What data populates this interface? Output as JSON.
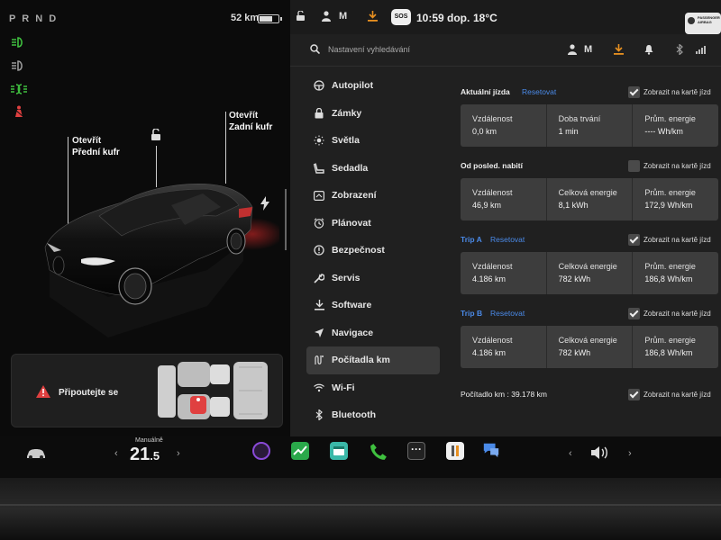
{
  "car_panel": {
    "gear": "P R N D",
    "range": "52 km",
    "frunk_label": "Otevřít",
    "frunk_sub": "Přední kufr",
    "trunk_label": "Otevřít",
    "trunk_sub": "Zadní kufr",
    "seatbelt_warning": "Připoutejte se"
  },
  "status_bar": {
    "profile": "M",
    "sos": "SOS",
    "time": "10:59 dop.",
    "temperature": "18°C",
    "airbag_text": "PASSENGER AIRBAG"
  },
  "settings": {
    "search": {
      "placeholder": "Nastavení vyhledávání"
    },
    "profile": "M",
    "menu": [
      {
        "label": "Autopilot",
        "icon": "steering-wheel-icon"
      },
      {
        "label": "Zámky",
        "icon": "lock-icon"
      },
      {
        "label": "Světla",
        "icon": "sun-icon"
      },
      {
        "label": "Sedadla",
        "icon": "seat-icon"
      },
      {
        "label": "Zobrazení",
        "icon": "display-icon"
      },
      {
        "label": "Plánovat",
        "icon": "alarm-clock-icon"
      },
      {
        "label": "Bezpečnost",
        "icon": "info-circle-icon"
      },
      {
        "label": "Servis",
        "icon": "wrench-icon"
      },
      {
        "label": "Software",
        "icon": "download-icon"
      },
      {
        "label": "Navigace",
        "icon": "navigation-icon"
      },
      {
        "label": "Počítadla km",
        "icon": "odometer-icon",
        "active": true
      },
      {
        "label": "Wi-Fi",
        "icon": "wifi-icon"
      },
      {
        "label": "Bluetooth",
        "icon": "bluetooth-icon"
      }
    ],
    "show_on_card": "Zobrazit na kartě jízd",
    "reset": "Resetovat",
    "current_drive": {
      "title": "Aktuální jízda",
      "show_checked": true,
      "cells": [
        {
          "k": "Vzdálenost",
          "v": "0,0  km"
        },
        {
          "k": "Doba trvání",
          "v": "1 min"
        },
        {
          "k": "Prům. energie",
          "v": "----  Wh/km"
        }
      ]
    },
    "since_charge": {
      "title": "Od posled. nabití",
      "show_checked": false,
      "cells": [
        {
          "k": "Vzdálenost",
          "v": "46,9  km"
        },
        {
          "k": "Celková energie",
          "v": "8,1  kWh"
        },
        {
          "k": "Prům. energie",
          "v": "172,9  Wh/km"
        }
      ]
    },
    "trip_a": {
      "title": "Trip A",
      "show_checked": true,
      "cells": [
        {
          "k": "Vzdálenost",
          "v": "4.186  km"
        },
        {
          "k": "Celková energie",
          "v": "782  kWh"
        },
        {
          "k": "Prům. energie",
          "v": "186,8  Wh/km"
        }
      ]
    },
    "trip_b": {
      "title": "Trip B",
      "show_checked": true,
      "cells": [
        {
          "k": "Vzdálenost",
          "v": "4.186  km"
        },
        {
          "k": "Celková energie",
          "v": "782  kWh"
        },
        {
          "k": "Prům. energie",
          "v": "186,8  Wh/km"
        }
      ]
    },
    "odometer": "Počítadlo km :  39.178  km",
    "odometer_checked": true
  },
  "taskbar": {
    "mode": "Manuálně",
    "temp_int": "21",
    "temp_dec": ".5"
  },
  "colors": {
    "accent": "#4a8ae8",
    "warning": "#e04040",
    "green": "#3fc03f"
  }
}
